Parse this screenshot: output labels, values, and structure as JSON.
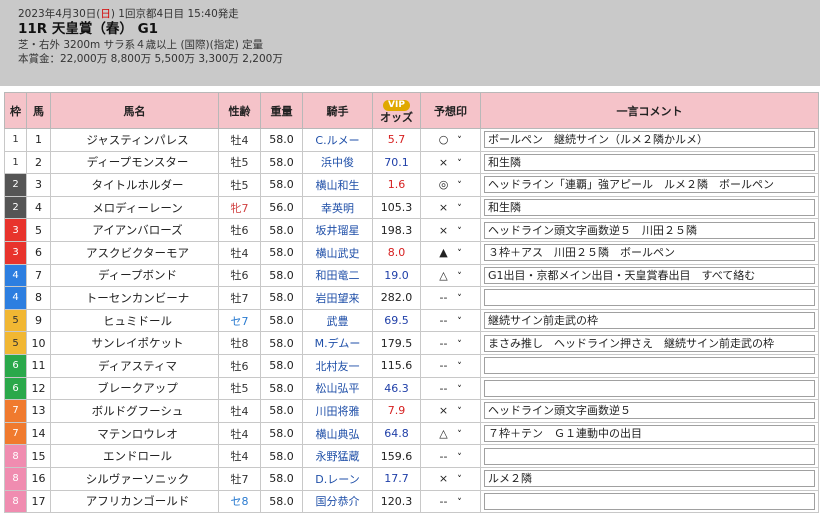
{
  "header": {
    "date_pre": "2023年4月30日(",
    "date_day": "日",
    "date_post": ") 1回京都4日目 15:40発走",
    "race_title": "11R 天皇賞（春） G1",
    "conditions": "芝・右外 3200m サラ系４歳以上 (国際)(指定) 定量",
    "prize": "本賞金：22,000万 8,800万 5,500万 3,300万 2,200万"
  },
  "columns": {
    "waku": "枠",
    "umaban": "馬",
    "horse_name": "馬名",
    "sex_age": "性齢",
    "weight": "重量",
    "jockey": "騎手",
    "vip_badge": "VIP",
    "odds": "オッズ",
    "prediction": "予想印",
    "comment": "一言コメント"
  },
  "colors": {
    "header_bg": "#c9c9c9",
    "table_header_bg": "#f5c3c9",
    "waku_1": "#ffffff",
    "waku_2": "#555555",
    "waku_3": "#e8332c",
    "waku_4": "#2c7ee0",
    "waku_5": "#f1b733",
    "waku_6": "#2aa84a",
    "waku_7": "#f07a2e",
    "waku_8": "#f08cb0"
  },
  "rows": [
    {
      "waku": "1",
      "num": "1",
      "name": "ジャスティンパレス",
      "sex_age": "牡4",
      "sex": "m",
      "weight": "58.0",
      "jockey": "C.ルメー",
      "odds": "5.7",
      "odds_color": "red",
      "pred": "○",
      "comment": "ボールペン　継続サイン（ルメ２隣かルメ）"
    },
    {
      "waku": "1",
      "num": "2",
      "name": "ディープモンスター",
      "sex_age": "牡5",
      "sex": "m",
      "weight": "58.0",
      "jockey": "浜中俊",
      "odds": "70.1",
      "odds_color": "blue",
      "pred": "×",
      "comment": "和生隣"
    },
    {
      "waku": "2",
      "num": "3",
      "name": "タイトルホルダー",
      "sex_age": "牡5",
      "sex": "m",
      "weight": "58.0",
      "jockey": "横山和生",
      "odds": "1.6",
      "odds_color": "red",
      "pred": "◎",
      "comment": "ヘッドライン「連覇」強アピール　ルメ２隣　ボールペン"
    },
    {
      "waku": "2",
      "num": "4",
      "name": "メロディーレーン",
      "sex_age": "牝7",
      "sex": "f",
      "weight": "56.0",
      "jockey": "幸英明",
      "odds": "105.3",
      "odds_color": "black",
      "pred": "×",
      "comment": "和生隣"
    },
    {
      "waku": "3",
      "num": "5",
      "name": "アイアンバローズ",
      "sex_age": "牡6",
      "sex": "m",
      "weight": "58.0",
      "jockey": "坂井瑠星",
      "odds": "198.3",
      "odds_color": "black",
      "pred": "×",
      "comment": "ヘッドライン頭文字画数逆５　川田２５隣"
    },
    {
      "waku": "3",
      "num": "6",
      "name": "アスクビクターモア",
      "sex_age": "牡4",
      "sex": "m",
      "weight": "58.0",
      "jockey": "横山武史",
      "odds": "8.0",
      "odds_color": "red",
      "pred": "▲",
      "comment": "３枠＋アス　川田２５隣　ボールペン"
    },
    {
      "waku": "4",
      "num": "7",
      "name": "ディープボンド",
      "sex_age": "牡6",
      "sex": "m",
      "weight": "58.0",
      "jockey": "和田竜二",
      "odds": "19.0",
      "odds_color": "blue",
      "pred": "△",
      "comment": "G1出目・京都メイン出目・天皇賞春出目　すべて絡む"
    },
    {
      "waku": "4",
      "num": "8",
      "name": "トーセンカンビーナ",
      "sex_age": "牡7",
      "sex": "m",
      "weight": "58.0",
      "jockey": "岩田望来",
      "odds": "282.0",
      "odds_color": "black",
      "pred": "--",
      "comment": ""
    },
    {
      "waku": "5",
      "num": "9",
      "name": "ヒュミドール",
      "sex_age": "セ7",
      "sex": "g",
      "weight": "58.0",
      "jockey": "武豊",
      "odds": "69.5",
      "odds_color": "blue",
      "pred": "--",
      "comment": "継続サイン前走武の枠"
    },
    {
      "waku": "5",
      "num": "10",
      "name": "サンレイポケット",
      "sex_age": "牡8",
      "sex": "m",
      "weight": "58.0",
      "jockey": "M.デムー",
      "odds": "179.5",
      "odds_color": "black",
      "pred": "--",
      "comment": "まさみ推し　ヘッドライン押さえ　継続サイン前走武の枠"
    },
    {
      "waku": "6",
      "num": "11",
      "name": "ディアスティマ",
      "sex_age": "牡6",
      "sex": "m",
      "weight": "58.0",
      "jockey": "北村友一",
      "odds": "115.6",
      "odds_color": "black",
      "pred": "--",
      "comment": ""
    },
    {
      "waku": "6",
      "num": "12",
      "name": "ブレークアップ",
      "sex_age": "牡5",
      "sex": "m",
      "weight": "58.0",
      "jockey": "松山弘平",
      "odds": "46.3",
      "odds_color": "blue",
      "pred": "--",
      "comment": ""
    },
    {
      "waku": "7",
      "num": "13",
      "name": "ボルドグフーシュ",
      "sex_age": "牡4",
      "sex": "m",
      "weight": "58.0",
      "jockey": "川田将雅",
      "odds": "7.9",
      "odds_color": "red",
      "pred": "×",
      "comment": "ヘッドライン頭文字画数逆５"
    },
    {
      "waku": "7",
      "num": "14",
      "name": "マテンロウレオ",
      "sex_age": "牡4",
      "sex": "m",
      "weight": "58.0",
      "jockey": "横山典弘",
      "odds": "64.8",
      "odds_color": "blue",
      "pred": "△",
      "comment": "７枠＋テン　Ｇ１連動中の出目"
    },
    {
      "waku": "8",
      "num": "15",
      "name": "エンドロール",
      "sex_age": "牡4",
      "sex": "m",
      "weight": "58.0",
      "jockey": "永野猛蔵",
      "odds": "159.6",
      "odds_color": "black",
      "pred": "--",
      "comment": ""
    },
    {
      "waku": "8",
      "num": "16",
      "name": "シルヴァーソニック",
      "sex_age": "牡7",
      "sex": "m",
      "weight": "58.0",
      "jockey": "D.レーン",
      "odds": "17.7",
      "odds_color": "blue",
      "pred": "×",
      "comment": "ルメ２隣"
    },
    {
      "waku": "8",
      "num": "17",
      "name": "アフリカンゴールド",
      "sex_age": "セ8",
      "sex": "g",
      "weight": "58.0",
      "jockey": "国分恭介",
      "odds": "120.3",
      "odds_color": "black",
      "pred": "--",
      "comment": ""
    }
  ]
}
